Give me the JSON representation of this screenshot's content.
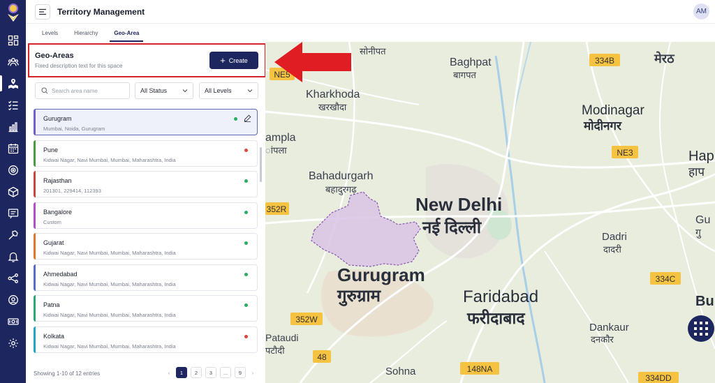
{
  "header": {
    "title": "Territory Management",
    "avatar_initials": "AM"
  },
  "tabs": [
    {
      "label": "Levels",
      "active": false
    },
    {
      "label": "Hierarchy",
      "active": false
    },
    {
      "label": "Geo-Area",
      "active": true
    }
  ],
  "geo_areas": {
    "title": "Geo-Areas",
    "description": "Fixed description text for this space",
    "create_label": "Create"
  },
  "filters": {
    "search_placeholder": "Search area name",
    "status": "All Status",
    "levels": "All Levels"
  },
  "list": [
    {
      "name": "Gurugram",
      "sub": "Mumbai, Noida, Gurugram",
      "color": "#6f5fc7",
      "status": "#27ae60",
      "selected": true
    },
    {
      "name": "Pune",
      "sub": "Kidwai Nagar, Navi Mumbai, Mumbai, Maharashtra, India",
      "color": "#4a9a3f",
      "status": "#e0463c",
      "selected": false
    },
    {
      "name": "Rajasthan",
      "sub": "201301, 229414, 112393",
      "color": "#c9463d",
      "status": "#27ae60",
      "selected": false
    },
    {
      "name": "Bangalore",
      "sub": "Custom",
      "color": "#b04ec7",
      "status": "#27ae60",
      "selected": false
    },
    {
      "name": "Gujarat",
      "sub": "Kidwai Nagar, Navi Mumbai, Mumbai, Maharashtra, India",
      "color": "#e0782a",
      "status": "#27ae60",
      "selected": false
    },
    {
      "name": "Ahmedabad",
      "sub": "Kidwai Nagar, Navi Mumbai, Mumbai, Maharashtra, India",
      "color": "#5a6bcc",
      "status": "#27ae60",
      "selected": false
    },
    {
      "name": "Patna",
      "sub": "Kidwai Nagar, Navi Mumbai, Mumbai, Maharashtra, India",
      "color": "#2aa876",
      "status": "#27ae60",
      "selected": false
    },
    {
      "name": "Kolkata",
      "sub": "Kidwai Nagar, Navi Mumbai, Mumbai, Maharashtra, India",
      "color": "#21a5c4",
      "status": "#e0463c",
      "selected": false
    }
  ],
  "footer": {
    "entries": "Showing 1-10 of 12 entries",
    "pages": [
      "1",
      "2",
      "3",
      "...",
      "9"
    ],
    "prev": "‹",
    "next": "›"
  },
  "map": {
    "labels": [
      {
        "text": "सोनीपत"
      },
      {
        "text": "मेरठ"
      },
      {
        "text": "Baghpat"
      },
      {
        "text": "बागपत"
      },
      {
        "text": "Kharkhoda"
      },
      {
        "text": "खरखौदा"
      },
      {
        "text": "Modinagar"
      },
      {
        "text": "मोदीनगर"
      },
      {
        "text": "ampla"
      },
      {
        "text": "ांपला"
      },
      {
        "text": "Bahadurgarh"
      },
      {
        "text": "बहादुरगढ़"
      },
      {
        "text": "New Delhi"
      },
      {
        "text": "नई दिल्ली"
      },
      {
        "text": "Hap"
      },
      {
        "text": "हाप"
      },
      {
        "text": "Dadri"
      },
      {
        "text": "दादरी"
      },
      {
        "text": "Gu"
      },
      {
        "text": "गु"
      },
      {
        "text": "Gurugram"
      },
      {
        "text": "गुरुग्राम"
      },
      {
        "text": "Faridabad"
      },
      {
        "text": "फरीदाबाद"
      },
      {
        "text": "Pataudi"
      },
      {
        "text": "पटौदी"
      },
      {
        "text": "Dankaur"
      },
      {
        "text": "दनकौर"
      },
      {
        "text": "Sohna"
      },
      {
        "text": "Bu"
      }
    ],
    "shields": [
      {
        "text": "334B"
      },
      {
        "text": "NE5"
      },
      {
        "text": "NE3"
      },
      {
        "text": "352R"
      },
      {
        "text": "334C"
      },
      {
        "text": "352W"
      },
      {
        "text": "48"
      },
      {
        "text": "148NA"
      },
      {
        "text": "334DD"
      }
    ]
  },
  "colors": {
    "brand": "#1e2660",
    "annotation": "#d6242d"
  }
}
